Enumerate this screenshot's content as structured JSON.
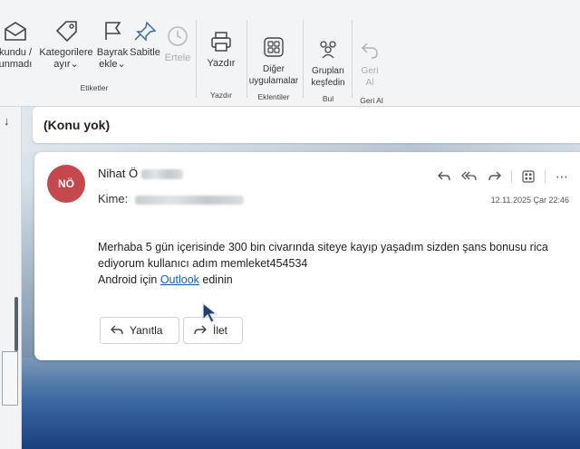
{
  "ribbon": {
    "items": [
      {
        "label": "kundu /\nunmadı",
        "icon": "envelope-open-icon"
      },
      {
        "label": "Kategorilere\nayır",
        "icon": "tag-icon"
      },
      {
        "label": "Bayrak\nekle",
        "icon": "flag-icon"
      },
      {
        "label": "Sabitle",
        "icon": "pin-icon"
      },
      {
        "label": "Ertele",
        "icon": "clock-icon"
      },
      {
        "label": "Yazdır",
        "icon": "printer-icon"
      },
      {
        "label": "Diğer\nuygulamalar",
        "icon": "apps-grid-icon"
      },
      {
        "label": "Grupları\nkeşfedin",
        "icon": "people-icon"
      },
      {
        "label": "Geri\nAl",
        "icon": "undo-icon"
      }
    ],
    "groups": {
      "etiketler": "Etiketler",
      "yazdir": "Yazdır",
      "eklentiler": "Eklentiler",
      "bul": "Bul",
      "geri_al": "Geri Al"
    }
  },
  "subject": "(Konu yok)",
  "message": {
    "avatar_initials": "NÖ",
    "avatar_color": "#c5484f",
    "sender_name": "Nihat Ö",
    "to_label": "Kime:",
    "timestamp": "12.11.2025 Çar 22:46",
    "body_line1": "Merhaba 5 gün içerisinde 300 bin civarında siteye kayıp yaşadım sizden şans bonusu rica ediyorum kullanıcı adım memleket454534",
    "body_line2_prefix": "Android için",
    "body_link": "Outlook",
    "body_line2_suffix": "edinin",
    "reply_label": "Yanıtla",
    "forward_label": "İlet"
  },
  "colors": {
    "accent_link": "#1a5fb4",
    "avatar": "#c5484f"
  }
}
